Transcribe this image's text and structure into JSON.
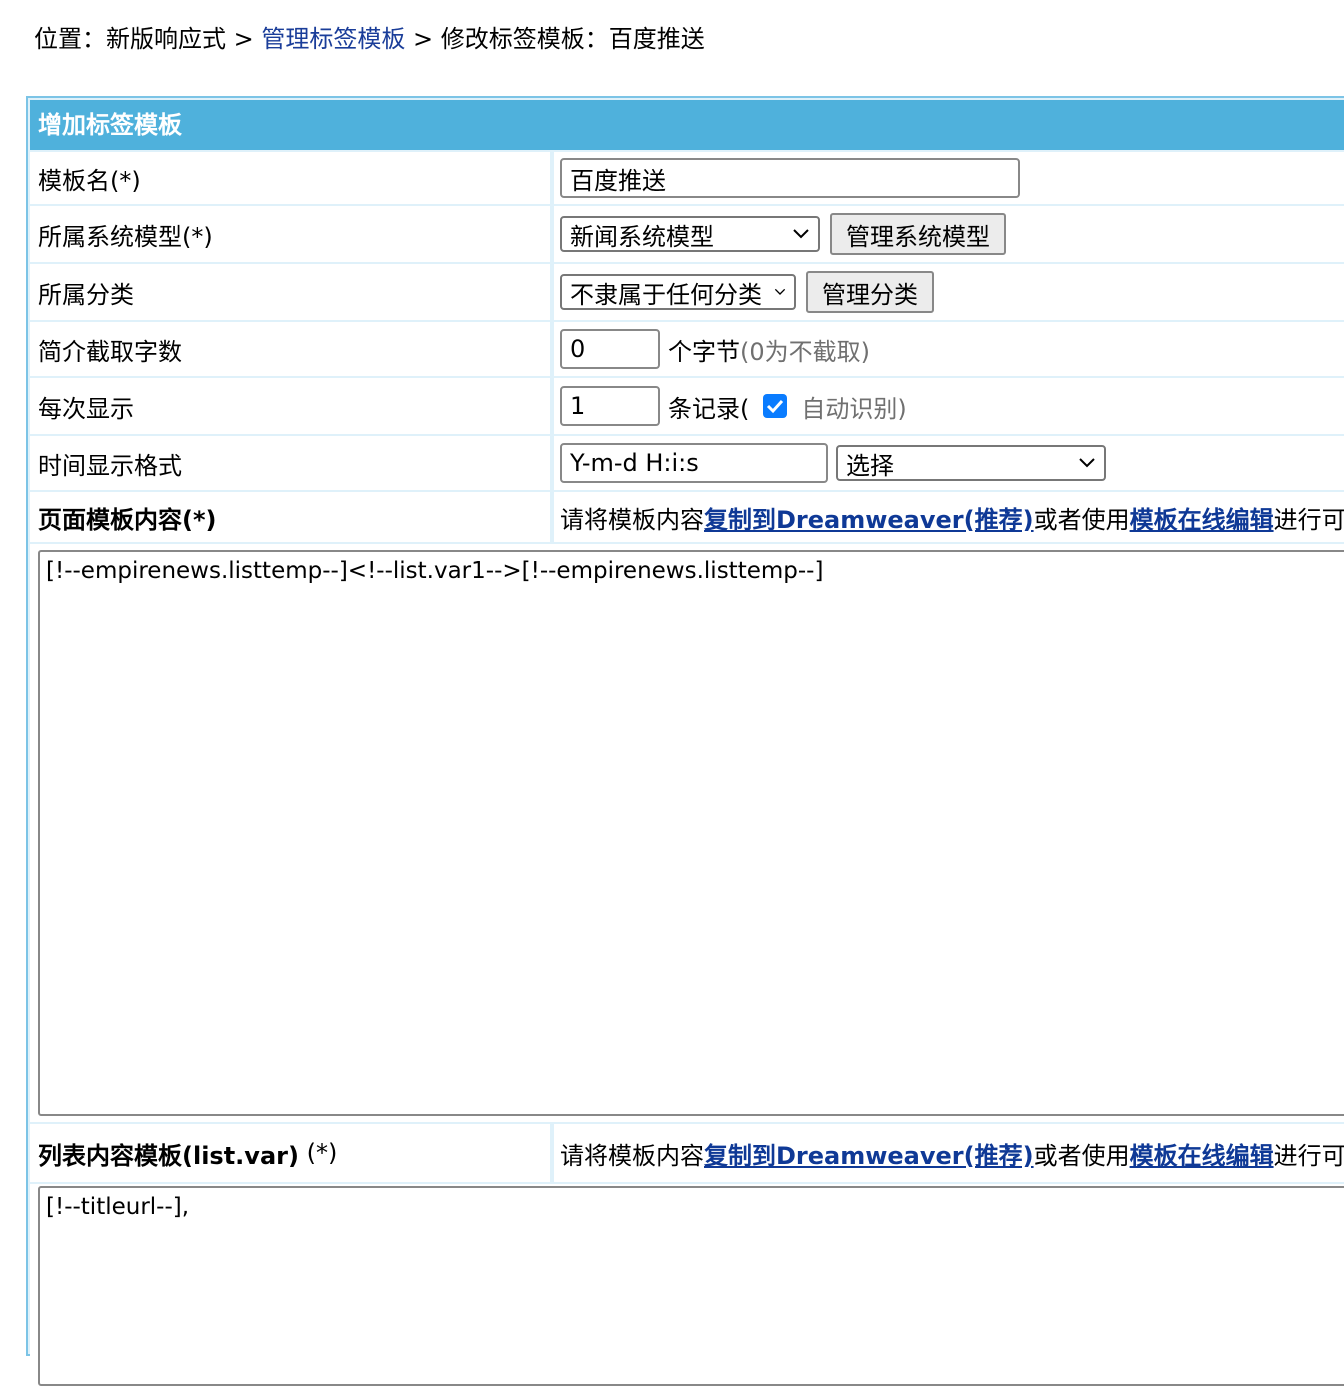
{
  "breadcrumb": {
    "prefix": "位置：",
    "item1": "新版响应式",
    "sep1": ">",
    "link": "管理标签模板",
    "sep2": ">",
    "current": "修改标签模板：百度推送"
  },
  "panel": {
    "title": "增加标签模板"
  },
  "form": {
    "template_name": {
      "label": "模板名(*)",
      "value": "百度推送"
    },
    "system_model": {
      "label": "所属系统模型(*)",
      "selected": "新闻系统模型",
      "button": "管理系统模型"
    },
    "category": {
      "label": "所属分类",
      "selected": "不隶属于任何分类",
      "button": "管理分类"
    },
    "summary_length": {
      "label": "简介截取字数",
      "value": "0",
      "unit": "个字节",
      "hint": "(0为不截取)"
    },
    "per_display": {
      "label": "每次显示",
      "value": "1",
      "unit": "条记录(",
      "checkbox_checked": true,
      "checkbox_label": "自动识别)"
    },
    "time_format": {
      "label": "时间显示格式",
      "value": "Y-m-d H:i:s",
      "select": "选择"
    },
    "page_template": {
      "label": "页面模板内容(*)",
      "hint_prefix": "请将模板内容",
      "hint_link1": "复制到Dreamweaver(推荐)",
      "hint_mid": "或者使用",
      "hint_link2": "模板在线编辑",
      "hint_suffix": "进行可视",
      "content": "[!--empirenews.listtemp--]<!--list.var1-->[!--empirenews.listtemp--]"
    },
    "list_template": {
      "label": "列表内容模板(list.var)",
      "label_suffix": " (*)",
      "hint_prefix": "请将模板内容",
      "hint_link1": "复制到Dreamweaver(推荐)",
      "hint_mid": "或者使用",
      "hint_link2": "模板在线编辑",
      "hint_suffix": "进行可视",
      "content": "[!--titleurl--],"
    }
  },
  "colors": {
    "header_bg": "#4fb1dc",
    "panel_border": "#7cc4e6",
    "link": "#1a3d99",
    "checkbox": "#0a7cff"
  }
}
